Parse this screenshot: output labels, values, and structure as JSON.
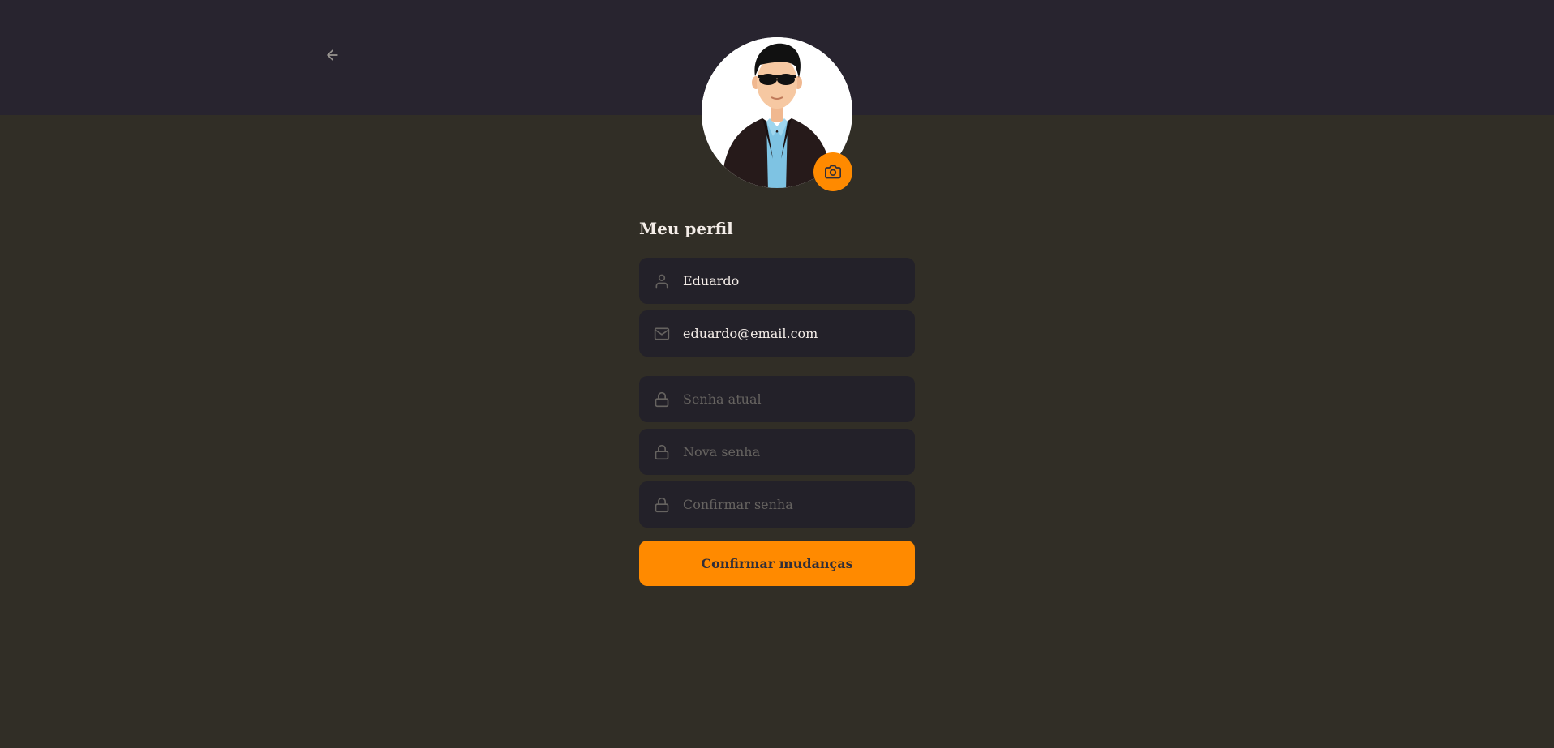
{
  "colors": {
    "background": "#312e26",
    "header": "#28242f",
    "input_bg": "#232129",
    "accent": "#ff8a00",
    "text": "#f4ede8",
    "placeholder": "#666360",
    "icon": "#666360"
  },
  "header": {
    "back_icon": "arrow-left-icon"
  },
  "avatar": {
    "image": "illustrated-man-with-sunglasses",
    "camera_icon": "camera-icon"
  },
  "page": {
    "title": "Meu perfil"
  },
  "form": {
    "name": {
      "icon": "user-icon",
      "value": "Eduardo",
      "placeholder": ""
    },
    "email": {
      "icon": "mail-icon",
      "value": "eduardo@email.com",
      "placeholder": ""
    },
    "old_password": {
      "icon": "lock-icon",
      "value": "",
      "placeholder": "Senha atual"
    },
    "new_password": {
      "icon": "lock-icon",
      "value": "",
      "placeholder": "Nova senha"
    },
    "confirm_password": {
      "icon": "lock-icon",
      "value": "",
      "placeholder": "Confirmar senha"
    },
    "submit_label": "Confirmar mudanças"
  }
}
